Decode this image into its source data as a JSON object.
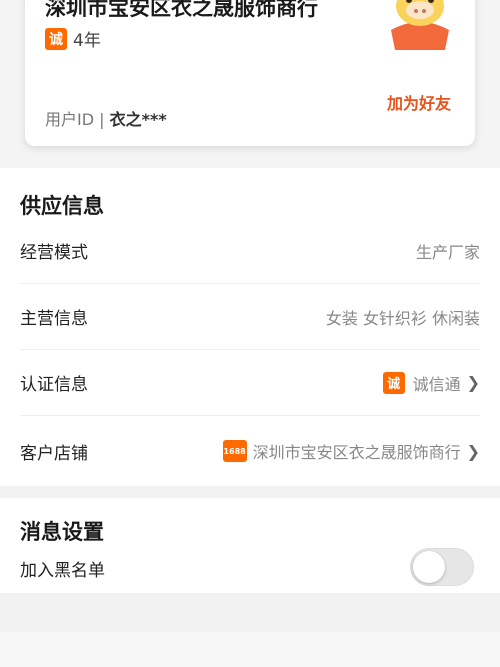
{
  "profile": {
    "shop_name": "深圳市宝安区衣之晟服饰商行",
    "trust_icon_char": "诚",
    "years": "4年",
    "user_id_label": "用户ID | ",
    "user_id_value": "衣之***",
    "add_friend": "加为好友",
    "mascot_icon": "cartoon-mascot-icon"
  },
  "supply": {
    "title": "供应信息",
    "rows": [
      {
        "label": "经营模式",
        "value": "生产厂家"
      },
      {
        "label": "主营信息",
        "value": "女装 女针织衫 休闲装"
      },
      {
        "label": "认证信息",
        "value": "诚信通",
        "icon_char": "诚"
      },
      {
        "label": "客户店铺",
        "value": "深圳市宝安区衣之晟服饰商行",
        "badge": "1688"
      }
    ]
  },
  "message": {
    "title": "消息设置",
    "blacklist_label": "加入黑名单",
    "blacklist_on": false
  },
  "colors": {
    "accent": "#ff6a00",
    "link": "#e8541c"
  }
}
